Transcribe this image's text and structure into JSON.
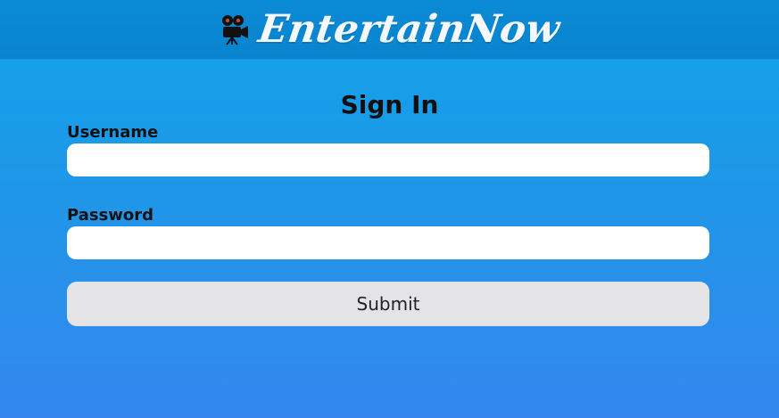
{
  "app": {
    "brand_name": "EntertainNow",
    "brand_icon": "movie-camera-icon"
  },
  "page": {
    "title": "Sign In"
  },
  "form": {
    "username_label": "Username",
    "username_value": "",
    "username_placeholder": "",
    "password_label": "Password",
    "password_value": "",
    "password_placeholder": "",
    "submit_label": "Submit"
  },
  "colors": {
    "header": "#0884cd",
    "background_top": "#0fa3ea",
    "background_bottom": "#3487ee",
    "input_background": "#ffffff",
    "button_background": "#e4e4e6"
  }
}
